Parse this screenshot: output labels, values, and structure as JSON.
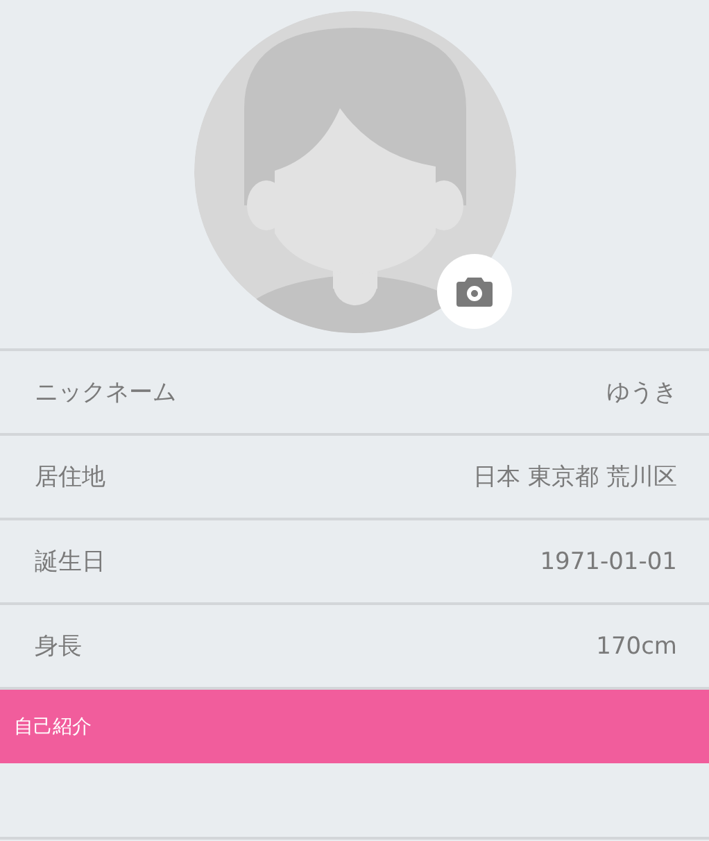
{
  "profile_fields": [
    {
      "label": "ニックネーム",
      "value": "ゆうき"
    },
    {
      "label": "居住地",
      "value": "日本 東京都 荒川区"
    },
    {
      "label": "誕生日",
      "value": "1971-01-01"
    },
    {
      "label": "身長",
      "value": "170cm"
    }
  ],
  "section_header": "自己紹介"
}
